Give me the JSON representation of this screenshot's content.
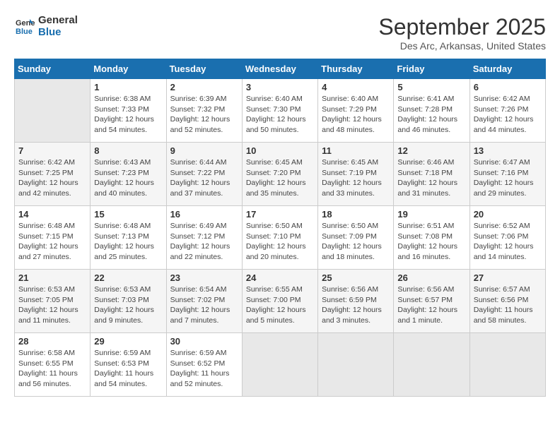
{
  "header": {
    "logo_line1": "General",
    "logo_line2": "Blue",
    "month_title": "September 2025",
    "subtitle": "Des Arc, Arkansas, United States"
  },
  "weekdays": [
    "Sunday",
    "Monday",
    "Tuesday",
    "Wednesday",
    "Thursday",
    "Friday",
    "Saturday"
  ],
  "weeks": [
    [
      {
        "day": "",
        "info": ""
      },
      {
        "day": "1",
        "info": "Sunrise: 6:38 AM\nSunset: 7:33 PM\nDaylight: 12 hours\nand 54 minutes."
      },
      {
        "day": "2",
        "info": "Sunrise: 6:39 AM\nSunset: 7:32 PM\nDaylight: 12 hours\nand 52 minutes."
      },
      {
        "day": "3",
        "info": "Sunrise: 6:40 AM\nSunset: 7:30 PM\nDaylight: 12 hours\nand 50 minutes."
      },
      {
        "day": "4",
        "info": "Sunrise: 6:40 AM\nSunset: 7:29 PM\nDaylight: 12 hours\nand 48 minutes."
      },
      {
        "day": "5",
        "info": "Sunrise: 6:41 AM\nSunset: 7:28 PM\nDaylight: 12 hours\nand 46 minutes."
      },
      {
        "day": "6",
        "info": "Sunrise: 6:42 AM\nSunset: 7:26 PM\nDaylight: 12 hours\nand 44 minutes."
      }
    ],
    [
      {
        "day": "7",
        "info": "Sunrise: 6:42 AM\nSunset: 7:25 PM\nDaylight: 12 hours\nand 42 minutes."
      },
      {
        "day": "8",
        "info": "Sunrise: 6:43 AM\nSunset: 7:23 PM\nDaylight: 12 hours\nand 40 minutes."
      },
      {
        "day": "9",
        "info": "Sunrise: 6:44 AM\nSunset: 7:22 PM\nDaylight: 12 hours\nand 37 minutes."
      },
      {
        "day": "10",
        "info": "Sunrise: 6:45 AM\nSunset: 7:20 PM\nDaylight: 12 hours\nand 35 minutes."
      },
      {
        "day": "11",
        "info": "Sunrise: 6:45 AM\nSunset: 7:19 PM\nDaylight: 12 hours\nand 33 minutes."
      },
      {
        "day": "12",
        "info": "Sunrise: 6:46 AM\nSunset: 7:18 PM\nDaylight: 12 hours\nand 31 minutes."
      },
      {
        "day": "13",
        "info": "Sunrise: 6:47 AM\nSunset: 7:16 PM\nDaylight: 12 hours\nand 29 minutes."
      }
    ],
    [
      {
        "day": "14",
        "info": "Sunrise: 6:48 AM\nSunset: 7:15 PM\nDaylight: 12 hours\nand 27 minutes."
      },
      {
        "day": "15",
        "info": "Sunrise: 6:48 AM\nSunset: 7:13 PM\nDaylight: 12 hours\nand 25 minutes."
      },
      {
        "day": "16",
        "info": "Sunrise: 6:49 AM\nSunset: 7:12 PM\nDaylight: 12 hours\nand 22 minutes."
      },
      {
        "day": "17",
        "info": "Sunrise: 6:50 AM\nSunset: 7:10 PM\nDaylight: 12 hours\nand 20 minutes."
      },
      {
        "day": "18",
        "info": "Sunrise: 6:50 AM\nSunset: 7:09 PM\nDaylight: 12 hours\nand 18 minutes."
      },
      {
        "day": "19",
        "info": "Sunrise: 6:51 AM\nSunset: 7:08 PM\nDaylight: 12 hours\nand 16 minutes."
      },
      {
        "day": "20",
        "info": "Sunrise: 6:52 AM\nSunset: 7:06 PM\nDaylight: 12 hours\nand 14 minutes."
      }
    ],
    [
      {
        "day": "21",
        "info": "Sunrise: 6:53 AM\nSunset: 7:05 PM\nDaylight: 12 hours\nand 11 minutes."
      },
      {
        "day": "22",
        "info": "Sunrise: 6:53 AM\nSunset: 7:03 PM\nDaylight: 12 hours\nand 9 minutes."
      },
      {
        "day": "23",
        "info": "Sunrise: 6:54 AM\nSunset: 7:02 PM\nDaylight: 12 hours\nand 7 minutes."
      },
      {
        "day": "24",
        "info": "Sunrise: 6:55 AM\nSunset: 7:00 PM\nDaylight: 12 hours\nand 5 minutes."
      },
      {
        "day": "25",
        "info": "Sunrise: 6:56 AM\nSunset: 6:59 PM\nDaylight: 12 hours\nand 3 minutes."
      },
      {
        "day": "26",
        "info": "Sunrise: 6:56 AM\nSunset: 6:57 PM\nDaylight: 12 hours\nand 1 minute."
      },
      {
        "day": "27",
        "info": "Sunrise: 6:57 AM\nSunset: 6:56 PM\nDaylight: 11 hours\nand 58 minutes."
      }
    ],
    [
      {
        "day": "28",
        "info": "Sunrise: 6:58 AM\nSunset: 6:55 PM\nDaylight: 11 hours\nand 56 minutes."
      },
      {
        "day": "29",
        "info": "Sunrise: 6:59 AM\nSunset: 6:53 PM\nDaylight: 11 hours\nand 54 minutes."
      },
      {
        "day": "30",
        "info": "Sunrise: 6:59 AM\nSunset: 6:52 PM\nDaylight: 11 hours\nand 52 minutes."
      },
      {
        "day": "",
        "info": ""
      },
      {
        "day": "",
        "info": ""
      },
      {
        "day": "",
        "info": ""
      },
      {
        "day": "",
        "info": ""
      }
    ]
  ]
}
